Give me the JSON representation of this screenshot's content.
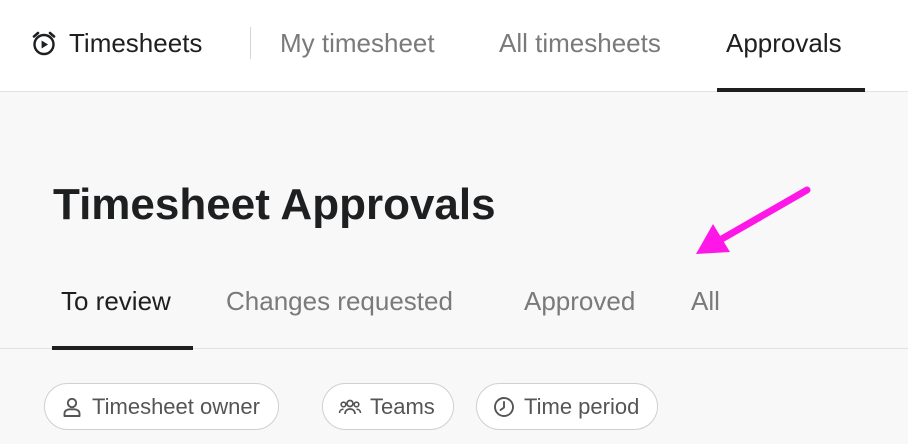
{
  "header": {
    "app_title": "Timesheets",
    "icon": "alarm-clock-play-icon",
    "nav": [
      {
        "label": "My timesheet",
        "active": false
      },
      {
        "label": "All timesheets",
        "active": false
      },
      {
        "label": "Approvals",
        "active": true
      }
    ]
  },
  "page": {
    "title": "Timesheet Approvals",
    "tabs": [
      {
        "label": "To review",
        "active": true
      },
      {
        "label": "Changes requested",
        "active": false
      },
      {
        "label": "Approved",
        "active": false
      },
      {
        "label": "All",
        "active": false
      }
    ]
  },
  "filters": [
    {
      "label": "Timesheet owner",
      "icon": "person-icon"
    },
    {
      "label": "Teams",
      "icon": "team-icon"
    },
    {
      "label": "Time period",
      "icon": "clock-icon"
    }
  ],
  "annotation": {
    "type": "arrow",
    "color": "#ff17e8",
    "points_to": "All"
  },
  "colors": {
    "text": "#1e1f21",
    "muted": "#7a7a7a",
    "background": "#f8f8f8"
  }
}
